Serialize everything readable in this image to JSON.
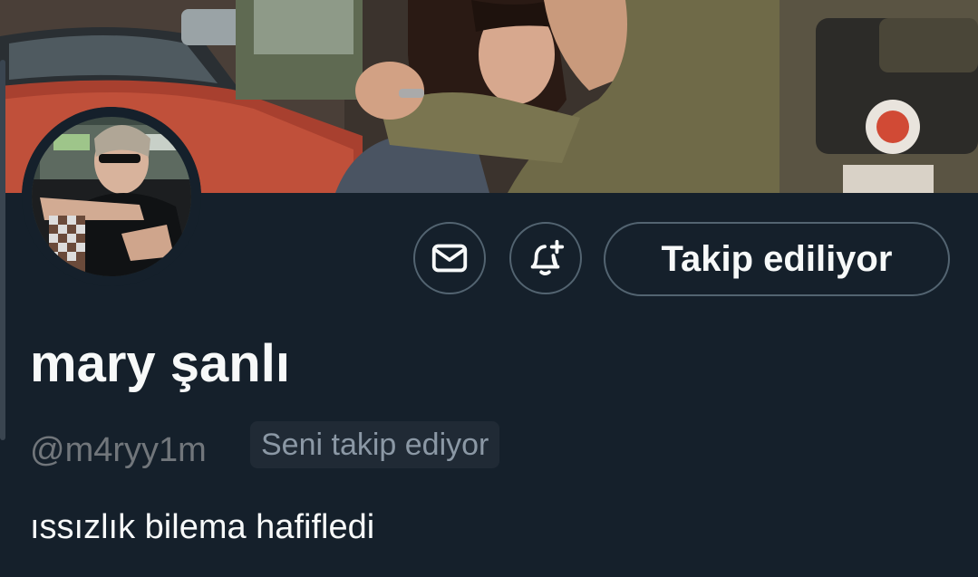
{
  "profile": {
    "display_name": "mary şanlı",
    "handle": "@m4ryy1m",
    "follows_you_badge": "Seni takip ediyor",
    "bio": "ıssızlık bilema hafifledi"
  },
  "actions": {
    "message_icon": "envelope-icon",
    "notify_icon": "bell-plus-icon",
    "follow_button_label": "Takip ediliyor"
  },
  "colors": {
    "background": "#15202b",
    "primary_text": "#f7f9f9",
    "secondary_text": "#71767b",
    "button_border": "#536471"
  }
}
